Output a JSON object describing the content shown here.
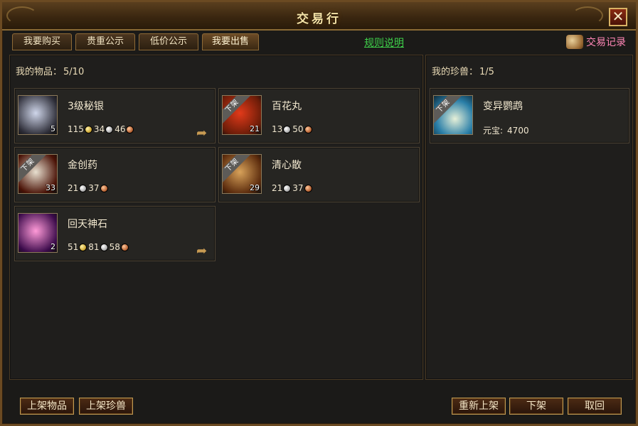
{
  "window": {
    "title": "交易行"
  },
  "tabs": [
    {
      "label": "我要购买"
    },
    {
      "label": "贵重公示"
    },
    {
      "label": "低价公示"
    },
    {
      "label": "我要出售"
    }
  ],
  "links": {
    "rules": "规则说明",
    "trade_record": "交易记录"
  },
  "items_panel": {
    "header_label": "我的物品：",
    "count": "5/10",
    "items": [
      {
        "name": "3级秘银",
        "qty": "5",
        "price": [
          "115",
          "34",
          "46"
        ],
        "coins": [
          "gold",
          "silver",
          "copper"
        ],
        "tag": "",
        "icon": "mithril-ore-icon",
        "colors": [
          "#2c2c36",
          "#cfd6ea"
        ]
      },
      {
        "name": "百花丸",
        "qty": "21",
        "price": [
          "13",
          "50"
        ],
        "coins": [
          "silver",
          "copper"
        ],
        "tag": "下架",
        "icon": "hundred-flower-pill-icon",
        "colors": [
          "#6a1c08",
          "#e23a1a"
        ]
      },
      {
        "name": "金创药",
        "qty": "33",
        "price": [
          "21",
          "37"
        ],
        "coins": [
          "silver",
          "copper"
        ],
        "tag": "下架",
        "icon": "wound-medicine-icon",
        "colors": [
          "#4a1206",
          "#e8e0d0"
        ]
      },
      {
        "name": "清心散",
        "qty": "29",
        "price": [
          "21",
          "37"
        ],
        "coins": [
          "silver",
          "copper"
        ],
        "tag": "下架",
        "icon": "clear-heart-powder-icon",
        "colors": [
          "#5a2a0c",
          "#d8a25a"
        ]
      },
      {
        "name": "回天神石",
        "qty": "2",
        "price": [
          "51",
          "81",
          "58"
        ],
        "coins": [
          "gold",
          "silver",
          "copper"
        ],
        "tag": "",
        "icon": "heaven-stone-icon",
        "colors": [
          "#3a0a4a",
          "#ff9ad8"
        ]
      }
    ]
  },
  "pets_panel": {
    "header_label": "我的珍兽：",
    "count": "1/5",
    "pets": [
      {
        "name": "变异鹦鹉",
        "price_label": "元宝:",
        "price": "4700",
        "tag": "下架",
        "icon": "mutant-parrot-icon",
        "colors": [
          "#2a7fa8",
          "#e6f0d8"
        ]
      }
    ]
  },
  "buttons": {
    "list_item": "上架物品",
    "list_pet": "上架珍兽",
    "relist": "重新上架",
    "delist": "下架",
    "cancel": "取回"
  }
}
